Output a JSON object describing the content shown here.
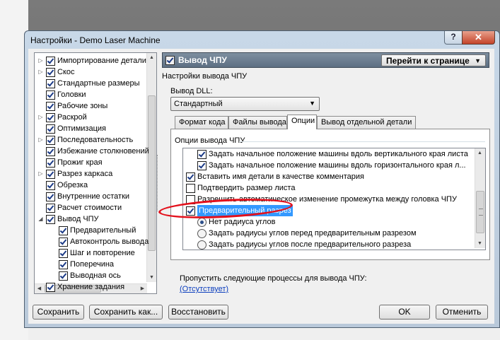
{
  "window": {
    "title": "Настройки - Demo Laser Machine",
    "help_label": "?",
    "close_label": "✕"
  },
  "tree": {
    "items": [
      {
        "label": "Импортирование детали",
        "level": 0,
        "expander": "▷"
      },
      {
        "label": "Скос",
        "level": 0,
        "expander": "▷"
      },
      {
        "label": "Стандартные размеры",
        "level": 0,
        "expander": ""
      },
      {
        "label": "Головки",
        "level": 0,
        "expander": ""
      },
      {
        "label": "Рабочие зоны",
        "level": 0,
        "expander": ""
      },
      {
        "label": "Раскрой",
        "level": 0,
        "expander": "▷"
      },
      {
        "label": "Оптимизация",
        "level": 0,
        "expander": ""
      },
      {
        "label": "Последовательность",
        "level": 0,
        "expander": "▷"
      },
      {
        "label": "Избежание столкновений",
        "level": 0,
        "expander": ""
      },
      {
        "label": "Прожиг края",
        "level": 0,
        "expander": ""
      },
      {
        "label": "Разрез каркаса",
        "level": 0,
        "expander": "▷"
      },
      {
        "label": "Обрезка",
        "level": 0,
        "expander": ""
      },
      {
        "label": "Внутренние остатки",
        "level": 0,
        "expander": ""
      },
      {
        "label": "Расчет стоимости",
        "level": 0,
        "expander": ""
      },
      {
        "label": "Вывод ЧПУ",
        "level": 0,
        "expander": "◢"
      },
      {
        "label": "Предварительный",
        "level": 1,
        "expander": ""
      },
      {
        "label": "Автоконтроль вывода",
        "level": 1,
        "expander": ""
      },
      {
        "label": "Шаг и повторение",
        "level": 1,
        "expander": ""
      },
      {
        "label": "Поперечина",
        "level": 1,
        "expander": ""
      },
      {
        "label": "Выводная ось",
        "level": 1,
        "expander": ""
      },
      {
        "label": "Хранение задания",
        "level": 0,
        "expander": ""
      }
    ]
  },
  "header": {
    "title": "Вывод ЧПУ",
    "goto_label": "Перейти к странице",
    "goto_arrow": "▼"
  },
  "section_title": "Настройки вывода ЧПУ",
  "dll": {
    "label": "Вывод DLL:",
    "value": "Стандартный",
    "arrow": "▼"
  },
  "tabs": [
    "Формат кода",
    "Файлы вывода",
    "Опции",
    "Вывод отдельной детали"
  ],
  "active_tab": "Опции",
  "options_group_label": "Опции вывода ЧПУ",
  "options": [
    {
      "label": "Задать начальное положение машины вдоль вертикального края листа",
      "kind": "checkbox",
      "checked": true,
      "indent": 1
    },
    {
      "label": "Задать начальное положение машины вдоль горизонтального края л...",
      "kind": "checkbox",
      "checked": true,
      "indent": 1
    },
    {
      "label": "Вставить имя детали в качестве комментария",
      "kind": "checkbox",
      "checked": true,
      "indent": 0
    },
    {
      "label": "Подтвердить размер листа",
      "kind": "checkbox",
      "checked": false,
      "indent": 0
    },
    {
      "label": "Разрешить автоматическое изменение промежутка между головка ЧПУ",
      "kind": "checkbox",
      "checked": false,
      "indent": 0
    },
    {
      "label": "Предварительный разрез",
      "kind": "checkbox",
      "checked": true,
      "indent": 0,
      "selected": true
    },
    {
      "label": "Нет радиуса углов",
      "kind": "radio",
      "checked": true,
      "indent": 1
    },
    {
      "label": "Задать радиусы углов перед предварительным разрезом",
      "kind": "radio",
      "checked": false,
      "indent": 1
    },
    {
      "label": "Задать радиусы углов после предварительного разреза",
      "kind": "radio",
      "checked": false,
      "indent": 1
    }
  ],
  "skip": {
    "label": "Пропустить следующие процессы для вывода ЧПУ:",
    "link": "(Отсутствует)"
  },
  "buttons": {
    "save": "Сохранить",
    "save_as": "Сохранить как...",
    "restore": "Восстановить",
    "ok": "OK",
    "cancel": "Отменить"
  },
  "colors": {
    "selection": "#3399ff",
    "annotation": "#e3101b",
    "header_bar": "#6a7c90"
  }
}
